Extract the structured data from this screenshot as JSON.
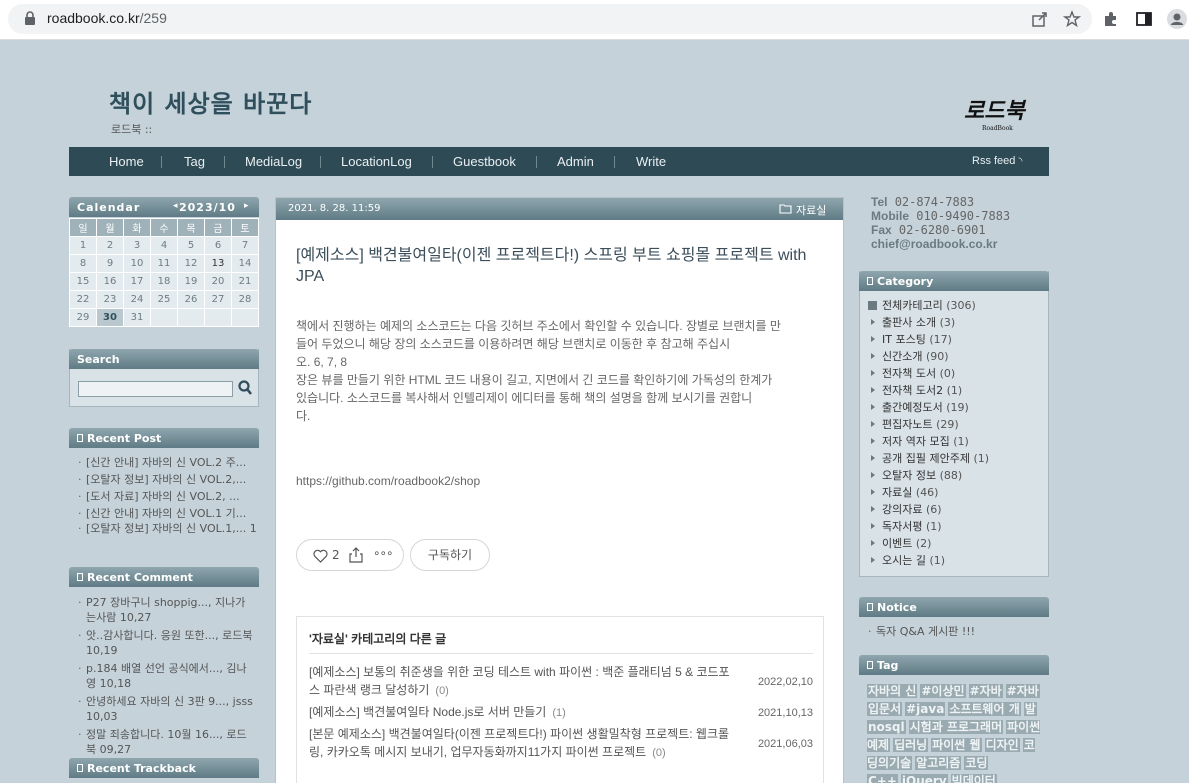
{
  "browser": {
    "url_domain": "roadbook.co.kr",
    "url_path": "/259"
  },
  "header": {
    "title": "책이 세상을 바꾼다",
    "subtitle": "로드북 ::",
    "logo_text": "로드북",
    "logo_sub": "RoadBook"
  },
  "nav": {
    "items": [
      "Home",
      "Tag",
      "MediaLog",
      "LocationLog",
      "Guestbook",
      "Admin",
      "Write"
    ],
    "rss": "Rss feed"
  },
  "calendar": {
    "title": "Calendar",
    "month": "2023/10",
    "weekdays": [
      "일",
      "월",
      "화",
      "수",
      "목",
      "금",
      "토"
    ],
    "weeks": [
      [
        "1",
        "2",
        "3",
        "4",
        "5",
        "6",
        "7"
      ],
      [
        "8",
        "9",
        "10",
        "11",
        "12",
        "13",
        "14"
      ],
      [
        "15",
        "16",
        "17",
        "18",
        "19",
        "20",
        "21"
      ],
      [
        "22",
        "23",
        "24",
        "25",
        "26",
        "27",
        "28"
      ],
      [
        "29",
        "30",
        "31",
        "",
        "",
        "",
        ""
      ]
    ]
  },
  "search": {
    "title": "Search"
  },
  "recent_post": {
    "title": "Recent Post",
    "items": [
      "[신간 안내] 자바의 신 VOL.2 주...",
      "[오탈자 정보] 자바의 신 VOL.2,...",
      "[도서 자료] 자바의 신 VOL.2, ...",
      "[신간 안내] 자바의 신 VOL.1 기...",
      "[오탈자 정보] 자바의 신 VOL.1,... 1"
    ]
  },
  "recent_comment": {
    "title": "Recent Comment",
    "items": [
      "P27 장바구니 shoppig..., 지나가는사람 10,27",
      "앗..감사합니다. 응원 또한..., 로드북 10,19",
      "p.184 배열 선언 공식에서..., 김나영 10,18",
      "안녕하세요 자바의 신 3판 9..., jsss 10,03",
      "정말 죄송합니다. 10월 16..., 로드북 09,27"
    ]
  },
  "recent_trackback": {
    "title": "Recent Trackback"
  },
  "post": {
    "date": "2021. 8. 28. 11:59",
    "category": "자료실",
    "title": "[예제소스] 백견불여일타(이젠 프로젝트다!) 스프링 부트 쇼핑몰 프로젝트 with JPA",
    "body": "책에서 진행하는 예제의 소스코드는 다음 깃허브 주소에서 확인할 수 있습니다. 장별로 브랜치를 만\n들어 두었으니 해당 장의 소스코드를 이용하려면 해당 브랜치로 이동한 후 참고해 주십시\n오. 6, 7, 8\n장은 뷰를 만들기 위한 HTML 코드 내용이 길고, 지면에서 긴 코드를 확인하기에 가독성의 한계가\n있습니다. 소스코드를 복사해서 인텔리제이 에디터를 통해 책의 설명을 함께 보시기를 권합니\n다.",
    "link": "https://github.com/roadbook2/shop",
    "likes": "2",
    "subscribe": "구독하기"
  },
  "related": {
    "title": "'자료실' 카테고리의 다른 글",
    "rows": [
      {
        "title": "[예제소스] 보통의 취준생을 위한 코딩 테스트 with 파이썬 : 백준 플래티넘 5 & 코드포스 파란색 랭크 달성하기",
        "count": "(0)",
        "date": "2022,02,10"
      },
      {
        "title": "[예제소스] 백견불여일타 Node.js로 서버 만들기",
        "count": "(1)",
        "date": "2021,10,13"
      },
      {
        "title": "[본문 예제소스] 백견불여일타(이젠 프로젝트다!) 파이썬 생활밀착형 프로젝트: 웹크롤링, 카카오톡 메시지 보내기, 업무자동화까지11가지 파이썬 프로젝트",
        "count": "(0)",
        "date": "2021,06,03"
      }
    ]
  },
  "contact": {
    "tel_label": "Tel",
    "tel": "02-874-7883",
    "mobile_label": "Mobile",
    "mobile": "010-9490-7883",
    "fax_label": "Fax",
    "fax": "02-6280-6901",
    "email": "chief@roadbook.co.kr"
  },
  "category": {
    "title": "Category",
    "root": {
      "name": "전체카테고리",
      "count": "(306)"
    },
    "items": [
      {
        "name": "출판사 소개",
        "count": "(3)"
      },
      {
        "name": "IT 포스팅",
        "count": "(17)"
      },
      {
        "name": "신간소개",
        "count": "(90)"
      },
      {
        "name": "전자책 도서",
        "count": "(0)"
      },
      {
        "name": "전자책 도서2",
        "count": "(1)"
      },
      {
        "name": "출간예정도서",
        "count": "(19)"
      },
      {
        "name": "편집자노트",
        "count": "(29)"
      },
      {
        "name": "저자 역자 모집",
        "count": "(1)"
      },
      {
        "name": "공개 집필 제안주제",
        "count": "(1)"
      },
      {
        "name": "오탈자 정보",
        "count": "(88)"
      },
      {
        "name": "자료실",
        "count": "(46)"
      },
      {
        "name": "강의자료",
        "count": "(6)"
      },
      {
        "name": "독자서평",
        "count": "(1)"
      },
      {
        "name": "이벤트",
        "count": "(2)"
      },
      {
        "name": "오시는 길",
        "count": "(1)"
      }
    ]
  },
  "notice": {
    "title": "Notice",
    "items": [
      "독자 Q&A 게시판 !!!"
    ]
  },
  "tag": {
    "title": "Tag",
    "items": [
      "자바의 신",
      "#이상민",
      "#자바",
      "#자바",
      "입문서",
      "#java",
      "소프트웨어 개",
      "발",
      "nosql",
      "시험과 프로그래머",
      "파이썬 예제",
      "딥러닝",
      "파이썬 웹",
      "디자인",
      "코딩의기술",
      "알고리즘",
      "코딩",
      "C++",
      "jQuery",
      "빅데이터"
    ]
  },
  "colors": {
    "page_bg": "#c5d2da",
    "nav_bg": "#2e4a54",
    "box_head": "#6f8b94"
  }
}
